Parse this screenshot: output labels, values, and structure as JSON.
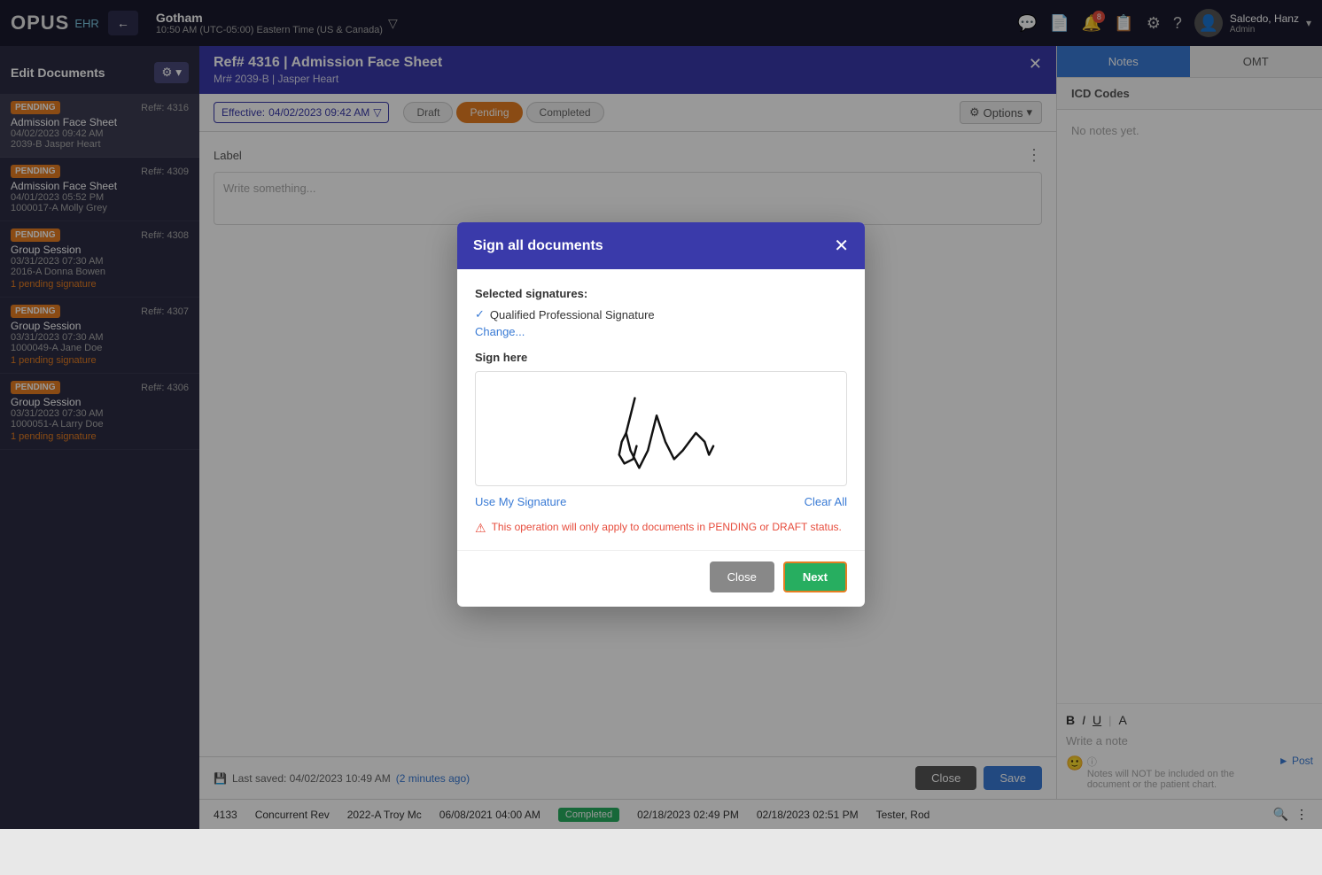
{
  "app": {
    "logo": "OPUS",
    "logo_ehr": "EHR"
  },
  "topnav": {
    "location_name": "Gotham",
    "location_time": "10:50 AM (UTC-05:00) Eastern Time (US & Canada)",
    "user_name": "Salcedo, Hanz",
    "user_role": "Admin"
  },
  "sidebar": {
    "header": "Edit Documents",
    "items": [
      {
        "badge": "PENDING",
        "ref": "Ref#: 4316",
        "title": "Admission Face Sheet",
        "date": "04/02/2023 09:42 AM",
        "patient": "2039-B Jasper Heart",
        "pending_sig": null,
        "active": true
      },
      {
        "badge": "PENDING",
        "ref": "Ref#: 4309",
        "title": "Admission Face Sheet",
        "date": "04/01/2023 05:52 PM",
        "patient": "1000017-A Molly Grey",
        "pending_sig": null,
        "active": false
      },
      {
        "badge": "PENDING",
        "ref": "Ref#: 4308",
        "title": "Group Session",
        "date": "03/31/2023 07:30 AM",
        "patient": "2016-A Donna Bowen",
        "pending_sig": "1 pending signature",
        "active": false
      },
      {
        "badge": "PENDING",
        "ref": "Ref#: 4307",
        "title": "Group Session",
        "date": "03/31/2023 07:30 AM",
        "patient": "1000049-A Jane Doe",
        "pending_sig": "1 pending signature",
        "active": false
      },
      {
        "badge": "PENDING",
        "ref": "Ref#: 4306",
        "title": "Group Session",
        "date": "03/31/2023 07:30 AM",
        "patient": "1000051-A Larry Doe",
        "pending_sig": "1 pending signature",
        "active": false
      }
    ]
  },
  "document": {
    "title": "Ref# 4316 | Admission Face Sheet",
    "subtitle": "Mr# 2039-B | Jasper Heart",
    "effective_label": "Effective:",
    "effective_date": "04/02/2023 09:42 AM",
    "status_draft": "Draft",
    "status_pending": "Pending",
    "status_completed": "Completed",
    "options_label": "Options",
    "label_field": "Label",
    "write_placeholder": "Write something...",
    "last_saved": "Last saved: 04/02/2023 10:49 AM",
    "minutes_ago": "(2 minutes ago)",
    "close_label": "Close",
    "save_label": "Save"
  },
  "right_panel": {
    "tab_notes": "Notes",
    "tab_omt": "OMT",
    "icd_label": "ICD Codes",
    "no_notes": "No notes yet.",
    "editor_bold": "B",
    "editor_italic": "I",
    "editor_underline": "U",
    "editor_font": "A",
    "write_note_placeholder": "Write a note",
    "note_hint": "Notes will NOT be included on the document or the patient chart.",
    "post_label": "Post"
  },
  "modal": {
    "title": "Sign all documents",
    "selected_sigs_label": "Selected signatures:",
    "sig_name": "Qualified Professional Signature",
    "change_label": "Change...",
    "sign_here_label": "Sign here",
    "use_my_sig": "Use My Signature",
    "clear_all": "Clear All",
    "warning": "This operation will only apply to documents in PENDING or DRAFT status.",
    "close_label": "Close",
    "next_label": "Next"
  },
  "bottom_row": {
    "ref": "4133",
    "type": "Concurrent Rev",
    "patient": "2022-A Troy Mc",
    "created": "06/08/2021 04:00 AM",
    "status": "Completed",
    "signed": "02/18/2023 02:49 PM",
    "modified": "02/18/2023 02:51 PM",
    "user": "Tester, Rod"
  }
}
